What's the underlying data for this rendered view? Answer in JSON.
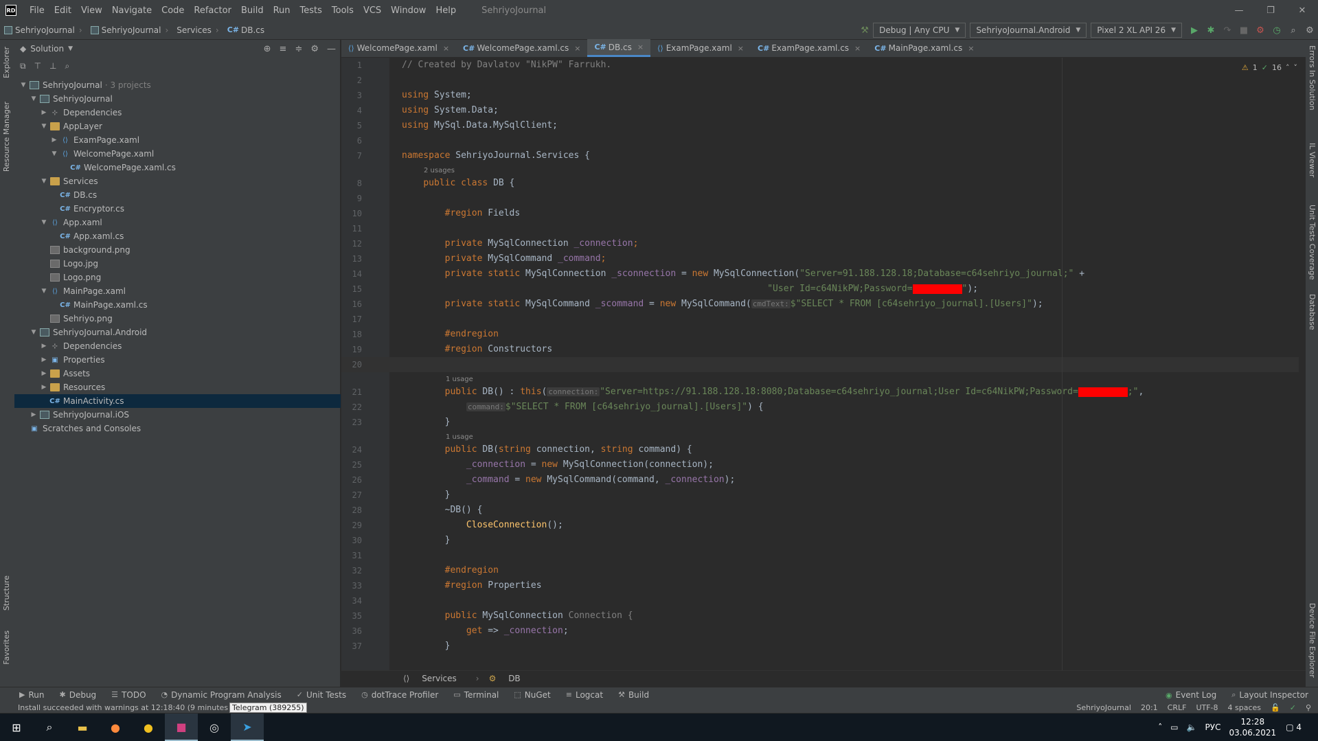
{
  "menubar": {
    "logo": "RD",
    "items": [
      "File",
      "Edit",
      "View",
      "Navigate",
      "Code",
      "Refactor",
      "Build",
      "Run",
      "Tests",
      "Tools",
      "VCS",
      "Window",
      "Help"
    ],
    "title": "SehriyoJournal",
    "window_controls": [
      "—",
      "❐",
      "✕"
    ]
  },
  "navbar": {
    "breadcrumbs": [
      "SehriyoJournal",
      "SehriyoJournal",
      "Services",
      "DB.cs"
    ],
    "config": "Debug | Any CPU",
    "project": "SehriyoJournal.Android",
    "device": "Pixel 2 XL API 26"
  },
  "left_strip": {
    "top_tabs": [
      "Explorer",
      "Resource Manager"
    ],
    "bottom_tabs": [
      "Structure",
      "Favorites"
    ]
  },
  "right_strip": {
    "tabs": [
      "Errors In Solution",
      "IL Viewer",
      "Unit Tests Coverage",
      "Database",
      "Device File Explorer"
    ]
  },
  "explorer": {
    "header": "Solution",
    "tree": [
      {
        "indent": 0,
        "arrow": "▼",
        "icon": "proj",
        "label": "SehriyoJournal",
        "muted": "· 3 projects"
      },
      {
        "indent": 1,
        "arrow": "▼",
        "icon": "proj",
        "label": "SehriyoJournal"
      },
      {
        "indent": 2,
        "arrow": "▶",
        "icon": "dep",
        "label": "Dependencies"
      },
      {
        "indent": 2,
        "arrow": "▼",
        "icon": "folder",
        "label": "AppLayer"
      },
      {
        "indent": 3,
        "arrow": "▶",
        "icon": "xaml",
        "label": "ExamPage.xaml"
      },
      {
        "indent": 3,
        "arrow": "▼",
        "icon": "xaml",
        "label": "WelcomePage.xaml"
      },
      {
        "indent": 4,
        "arrow": "",
        "icon": "cs",
        "label": "WelcomePage.xaml.cs"
      },
      {
        "indent": 2,
        "arrow": "▼",
        "icon": "folder",
        "label": "Services"
      },
      {
        "indent": 3,
        "arrow": "",
        "icon": "cs",
        "label": "DB.cs"
      },
      {
        "indent": 3,
        "arrow": "",
        "icon": "cs",
        "label": "Encryptor.cs"
      },
      {
        "indent": 2,
        "arrow": "▼",
        "icon": "xaml",
        "label": "App.xaml"
      },
      {
        "indent": 3,
        "arrow": "",
        "icon": "cs",
        "label": "App.xaml.cs"
      },
      {
        "indent": 2,
        "arrow": "",
        "icon": "img",
        "label": "background.png"
      },
      {
        "indent": 2,
        "arrow": "",
        "icon": "img",
        "label": "Logo.jpg"
      },
      {
        "indent": 2,
        "arrow": "",
        "icon": "img",
        "label": "Logo.png"
      },
      {
        "indent": 2,
        "arrow": "▼",
        "icon": "xaml",
        "label": "MainPage.xaml"
      },
      {
        "indent": 3,
        "arrow": "",
        "icon": "cs",
        "label": "MainPage.xaml.cs"
      },
      {
        "indent": 2,
        "arrow": "",
        "icon": "img",
        "label": "Sehriyo.png"
      },
      {
        "indent": 1,
        "arrow": "▼",
        "icon": "proj",
        "label": "SehriyoJournal.Android"
      },
      {
        "indent": 2,
        "arrow": "▶",
        "icon": "dep",
        "label": "Dependencies"
      },
      {
        "indent": 2,
        "arrow": "▶",
        "icon": "props",
        "label": "Properties"
      },
      {
        "indent": 2,
        "arrow": "▶",
        "icon": "folder",
        "label": "Assets"
      },
      {
        "indent": 2,
        "arrow": "▶",
        "icon": "folder",
        "label": "Resources"
      },
      {
        "indent": 2,
        "arrow": "",
        "icon": "cs",
        "label": "MainActivity.cs",
        "selected": true
      },
      {
        "indent": 1,
        "arrow": "▶",
        "icon": "proj",
        "label": "SehriyoJournal.iOS"
      },
      {
        "indent": 0,
        "arrow": "",
        "icon": "props",
        "label": "Scratches and Consoles"
      }
    ]
  },
  "tabs": [
    {
      "icon": "xaml",
      "label": "WelcomePage.xaml",
      "active": false
    },
    {
      "icon": "cs",
      "label": "WelcomePage.xaml.cs",
      "active": false
    },
    {
      "icon": "cs",
      "label": "DB.cs",
      "active": true
    },
    {
      "icon": "xaml",
      "label": "ExamPage.xaml",
      "active": false
    },
    {
      "icon": "cs",
      "label": "ExamPage.xaml.cs",
      "active": false
    },
    {
      "icon": "cs",
      "label": "MainPage.xaml.cs",
      "active": false
    }
  ],
  "analysis": {
    "warnings": "1",
    "ok": "16"
  },
  "code": [
    {
      "ln": "1",
      "tokens": [
        [
          "cm",
          "// Created by Davlatov \"NikPW\" Farrukh."
        ]
      ]
    },
    {
      "ln": "2",
      "tokens": []
    },
    {
      "ln": "3",
      "tokens": [
        [
          "kw",
          "using "
        ],
        [
          "plain",
          "System;"
        ]
      ]
    },
    {
      "ln": "4",
      "tokens": [
        [
          "kw",
          "using "
        ],
        [
          "plain",
          "System.Data;"
        ]
      ]
    },
    {
      "ln": "5",
      "tokens": [
        [
          "kw",
          "using "
        ],
        [
          "plain",
          "MySql.Data.MySqlClient;"
        ]
      ]
    },
    {
      "ln": "6",
      "tokens": []
    },
    {
      "ln": "7",
      "tokens": [
        [
          "kw",
          "namespace "
        ],
        [
          "plain",
          "SehriyoJournal.Services {"
        ]
      ]
    },
    {
      "hint": "2 usages",
      "indent": 1
    },
    {
      "ln": "8",
      "tokens": [
        [
          "plain",
          "    "
        ],
        [
          "kw",
          "public class "
        ],
        [
          "plain",
          "DB {"
        ]
      ]
    },
    {
      "ln": "9",
      "tokens": []
    },
    {
      "ln": "10",
      "tokens": [
        [
          "plain",
          "        "
        ],
        [
          "region",
          "#region "
        ],
        [
          "plain",
          "Fields"
        ]
      ]
    },
    {
      "ln": "11",
      "tokens": []
    },
    {
      "ln": "12",
      "tokens": [
        [
          "plain",
          "        "
        ],
        [
          "kw",
          "private "
        ],
        [
          "plain",
          "MySqlConnection "
        ],
        [
          "fld",
          "_connection"
        ],
        [
          "kw",
          ";"
        ]
      ]
    },
    {
      "ln": "13",
      "tokens": [
        [
          "plain",
          "        "
        ],
        [
          "kw",
          "private "
        ],
        [
          "plain",
          "MySqlCommand "
        ],
        [
          "fld",
          "_command"
        ],
        [
          "kw",
          ";"
        ]
      ]
    },
    {
      "ln": "14",
      "tokens": [
        [
          "plain",
          "        "
        ],
        [
          "kw",
          "private static "
        ],
        [
          "plain",
          "MySqlConnection "
        ],
        [
          "fld",
          "_sconnection"
        ],
        [
          "plain",
          " = "
        ],
        [
          "kw",
          "new "
        ],
        [
          "plain",
          "MySqlConnection("
        ],
        [
          "str",
          "\"Server=91.188.128.18;Database=c64sehriyo_journal;\""
        ],
        [
          "plain",
          " +"
        ]
      ]
    },
    {
      "ln": "15",
      "tokens": [
        [
          "plain",
          "                                                                    "
        ],
        [
          "str",
          "\"User Id=c64NikPW;Password="
        ],
        [
          "redact",
          ""
        ],
        [
          "str",
          "\""
        ],
        [
          "plain",
          ");"
        ]
      ]
    },
    {
      "ln": "16",
      "tokens": [
        [
          "plain",
          "        "
        ],
        [
          "kw",
          "private static "
        ],
        [
          "plain",
          "MySqlCommand "
        ],
        [
          "fld",
          "_scommand"
        ],
        [
          "plain",
          " = "
        ],
        [
          "kw",
          "new "
        ],
        [
          "plain",
          "MySqlCommand("
        ],
        [
          "hint",
          "cmdText:"
        ],
        [
          "str",
          "$\"SELECT * FROM [c64sehriyo_journal].[Users]\""
        ],
        [
          "plain",
          ");"
        ]
      ]
    },
    {
      "ln": "17",
      "tokens": []
    },
    {
      "ln": "18",
      "tokens": [
        [
          "plain",
          "        "
        ],
        [
          "region",
          "#endregion"
        ]
      ]
    },
    {
      "ln": "19",
      "tokens": [
        [
          "plain",
          "        "
        ],
        [
          "region",
          "#region "
        ],
        [
          "plain",
          "Constructors"
        ]
      ]
    },
    {
      "ln": "20",
      "tokens": [],
      "current": true
    },
    {
      "hint": "1 usage",
      "indent": 2
    },
    {
      "ln": "21",
      "tokens": [
        [
          "plain",
          "        "
        ],
        [
          "kw",
          "public "
        ],
        [
          "plain",
          "DB() : "
        ],
        [
          "kw",
          "this"
        ],
        [
          "plain",
          "("
        ],
        [
          "hint",
          "connection:"
        ],
        [
          "str",
          "\"Server=https://91.188.128.18:8080;Database=c64sehriyo_journal;User Id=c64NikPW;Password="
        ],
        [
          "redact",
          ""
        ],
        [
          "str",
          ";\""
        ],
        [
          "plain",
          ","
        ]
      ]
    },
    {
      "ln": "22",
      "tokens": [
        [
          "plain",
          "            "
        ],
        [
          "hint",
          "command:"
        ],
        [
          "str",
          "$\"SELECT * FROM [c64sehriyo_journal].[Users]\""
        ],
        [
          "plain",
          ") {"
        ]
      ]
    },
    {
      "ln": "23",
      "tokens": [
        [
          "plain",
          "        }"
        ]
      ]
    },
    {
      "hint": "1 usage",
      "indent": 2
    },
    {
      "ln": "24",
      "tokens": [
        [
          "plain",
          "        "
        ],
        [
          "kw",
          "public "
        ],
        [
          "plain",
          "DB("
        ],
        [
          "kw",
          "string "
        ],
        [
          "plain",
          "connection, "
        ],
        [
          "kw",
          "string "
        ],
        [
          "plain",
          "command) {"
        ]
      ]
    },
    {
      "ln": "25",
      "tokens": [
        [
          "plain",
          "            "
        ],
        [
          "fld",
          "_connection"
        ],
        [
          "plain",
          " = "
        ],
        [
          "kw",
          "new "
        ],
        [
          "plain",
          "MySqlConnection(connection);"
        ]
      ]
    },
    {
      "ln": "26",
      "tokens": [
        [
          "plain",
          "            "
        ],
        [
          "fld",
          "_command"
        ],
        [
          "plain",
          " = "
        ],
        [
          "kw",
          "new "
        ],
        [
          "plain",
          "MySqlCommand(command, "
        ],
        [
          "fld",
          "_connection"
        ],
        [
          "plain",
          ");"
        ]
      ]
    },
    {
      "ln": "27",
      "tokens": [
        [
          "plain",
          "        }"
        ]
      ]
    },
    {
      "ln": "28",
      "tokens": [
        [
          "plain",
          "        ~DB() {"
        ]
      ]
    },
    {
      "ln": "29",
      "tokens": [
        [
          "plain",
          "            "
        ],
        [
          "fn",
          "CloseConnection"
        ],
        [
          "plain",
          "();"
        ]
      ]
    },
    {
      "ln": "30",
      "tokens": [
        [
          "plain",
          "        }"
        ]
      ]
    },
    {
      "ln": "31",
      "tokens": []
    },
    {
      "ln": "32",
      "tokens": [
        [
          "plain",
          "        "
        ],
        [
          "region",
          "#endregion"
        ]
      ]
    },
    {
      "ln": "33",
      "tokens": [
        [
          "plain",
          "        "
        ],
        [
          "region",
          "#region "
        ],
        [
          "plain",
          "Properties"
        ]
      ]
    },
    {
      "ln": "34",
      "tokens": []
    },
    {
      "ln": "35",
      "tokens": [
        [
          "plain",
          "        "
        ],
        [
          "kw",
          "public "
        ],
        [
          "plain",
          "MySqlConnection "
        ],
        [
          "cm",
          "Connection {"
        ]
      ]
    },
    {
      "ln": "36",
      "tokens": [
        [
          "plain",
          "            "
        ],
        [
          "kw",
          "get "
        ],
        [
          "plain",
          "=> "
        ],
        [
          "fld",
          "_connection"
        ],
        [
          "plain",
          ";"
        ]
      ]
    },
    {
      "ln": "37",
      "tokens": [
        [
          "plain",
          "        }"
        ]
      ]
    }
  ],
  "editor_breadcrumb": [
    "Services",
    "DB"
  ],
  "bottom_tools": [
    {
      "icon": "▶",
      "label": "Run"
    },
    {
      "icon": "✱",
      "label": "Debug"
    },
    {
      "icon": "☰",
      "label": "TODO"
    },
    {
      "icon": "◔",
      "label": "Dynamic Program Analysis"
    },
    {
      "icon": "✓",
      "label": "Unit Tests"
    },
    {
      "icon": "◷",
      "label": "dotTrace Profiler"
    },
    {
      "icon": "▭",
      "label": "Terminal"
    },
    {
      "icon": "⬚",
      "label": "NuGet"
    },
    {
      "icon": "≡",
      "label": "Logcat"
    },
    {
      "icon": "⚒",
      "label": "Build"
    }
  ],
  "bottom_right_tools": [
    "Event Log",
    "Layout Inspector"
  ],
  "status": {
    "message": "Install succeeded with warnings at 12:18:40 (9 minutes",
    "tooltip": "Telegram (389255)",
    "project": "SehriyoJournal",
    "position": "20:1",
    "line_sep": "CRLF",
    "encoding": "UTF-8",
    "indent": "4 spaces"
  },
  "taskbar": {
    "lang": "РУС",
    "time": "12:28",
    "date": "03.06.2021",
    "notifications": "4"
  }
}
